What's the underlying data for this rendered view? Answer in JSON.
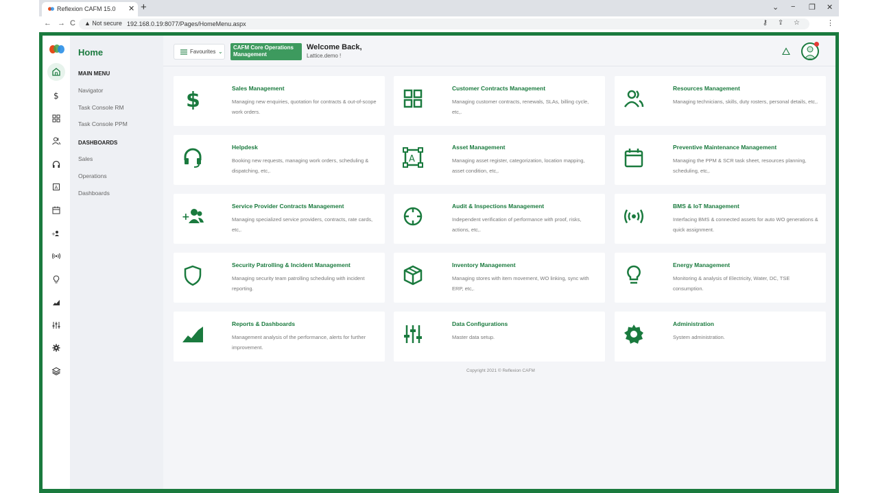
{
  "browser": {
    "tab_title": "Reflexion CAFM 15.0",
    "tab_close": "✕",
    "new_tab": "+",
    "url_warning": "▲ Not secure",
    "url": "192.168.0.19:8077/Pages/HomeMenu.aspx",
    "back": "←",
    "forward": "→",
    "reload": "C",
    "menu": "⋮",
    "controls": [
      "⌄",
      "−",
      "❐",
      "✕"
    ]
  },
  "menu": {
    "title": "Home",
    "main_menu_label": "MAIN MENU",
    "main_items": [
      "Navigator",
      "Task Console RM",
      "Task Console PPM"
    ],
    "dashboards_label": "DASHBOARDS",
    "dashboard_items": [
      "Sales",
      "Operations",
      "Dashboards"
    ]
  },
  "topbar": {
    "favourites_label": "Favourites",
    "core_ops_label": "CAFM Core Operations Management",
    "welcome": "Welcome Back,",
    "user": "Lattice.demo !"
  },
  "cards": [
    {
      "icon": "dollar-icon",
      "title": "Sales Management",
      "desc": "Managing new enquiries, quotation for contracts & out-of-scope work orders."
    },
    {
      "icon": "grid-icon",
      "title": "Customer Contracts Management",
      "desc": "Managing customer contracts, renewals, SLAs, billing cycle, etc,."
    },
    {
      "icon": "users-icon",
      "title": "Resources Management",
      "desc": "Managing technicians, skills, duty rosters, personal details, etc,."
    },
    {
      "icon": "headset-icon",
      "title": "Helpdesk",
      "desc": "Booking new requests, managing work orders, scheduling & dispatching, etc,."
    },
    {
      "icon": "asset-frame-icon",
      "title": "Asset Management",
      "desc": "Managing asset register, categorization, location mapping, asset condition, etc,."
    },
    {
      "icon": "calendar-icon",
      "title": "Preventive Maintenance Management",
      "desc": "Managing the PPM & SCR task sheet, resources planning, scheduling, etc,."
    },
    {
      "icon": "user-add-icon",
      "title": "Service Provider Contracts Management",
      "desc": "Managing specialized service providers, contracts, rate cards, etc,."
    },
    {
      "icon": "crosshair-icon",
      "title": "Audit & Inspections Management",
      "desc": "Independent verification of performance with proof, risks, actions, etc,."
    },
    {
      "icon": "broadcast-icon",
      "title": "BMS & IoT Management",
      "desc": "Interfacing BMS & connected assets for auto WO generations & quick assignment."
    },
    {
      "icon": "shield-icon",
      "title": "Security Patrolling & Incident Management",
      "desc": "Managing security team patrolling scheduling with incident reporting."
    },
    {
      "icon": "box-icon",
      "title": "Inventory Management",
      "desc": "Managing stores with item movement, WO linking, sync with ERP, etc,."
    },
    {
      "icon": "bulb-icon",
      "title": "Energy Management",
      "desc": "Monitoring & analysis of Electricity, Water, DC, TSE consumption."
    },
    {
      "icon": "area-chart-icon",
      "title": "Reports & Dashboards",
      "desc": "Management analysis of the performance, alerts for further improvement."
    },
    {
      "icon": "sliders-icon",
      "title": "Data Configurations",
      "desc": "Master data setup."
    },
    {
      "icon": "gear-icon",
      "title": "Administration",
      "desc": "System administration."
    }
  ],
  "footer": {
    "copyright": "Copyright 2021 © Reflexion CAFM"
  },
  "colors": {
    "brand_green": "#1a7a3e",
    "accent_green": "#3d9a5e"
  }
}
